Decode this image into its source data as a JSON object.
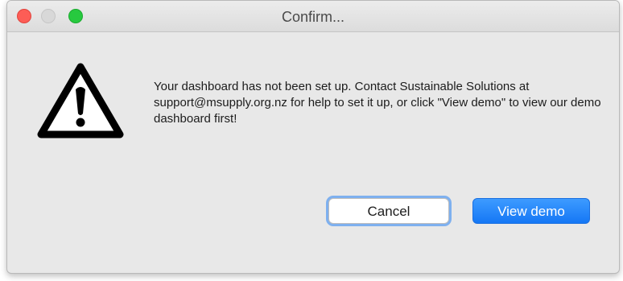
{
  "window": {
    "title": "Confirm..."
  },
  "dialog": {
    "icon": "warning-icon",
    "message": "Your dashboard has not been set up. Contact Sustainable Solutions at support@msupply.org.nz for help to set it up, or click \"View demo\" to view our demo dashboard first!",
    "cancel_label": "Cancel",
    "confirm_label": "View demo"
  },
  "colors": {
    "primary_button": "#1577f5",
    "focus_ring": "#7eb0ef",
    "close": "#fd5d56",
    "zoom": "#27c93f"
  }
}
